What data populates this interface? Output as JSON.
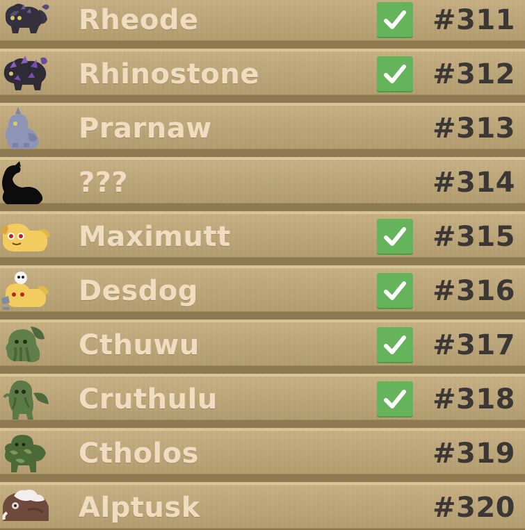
{
  "creatures": [
    {
      "name": "Rheode",
      "number": "#311",
      "caught": true,
      "icon": "rheode-sprite-icon"
    },
    {
      "name": "Rhinostone",
      "number": "#312",
      "caught": true,
      "icon": "rhinostone-sprite-icon"
    },
    {
      "name": "Prarnaw",
      "number": "#313",
      "caught": false,
      "icon": "prarnaw-sprite-icon"
    },
    {
      "name": "???",
      "number": "#314",
      "caught": false,
      "icon": "unknown-silhouette-icon"
    },
    {
      "name": "Maximutt",
      "number": "#315",
      "caught": true,
      "icon": "maximutt-sprite-icon"
    },
    {
      "name": "Desdog",
      "number": "#316",
      "caught": true,
      "icon": "desdog-sprite-icon"
    },
    {
      "name": "Cthuwu",
      "number": "#317",
      "caught": true,
      "icon": "cthuwu-sprite-icon"
    },
    {
      "name": "Cruthulu",
      "number": "#318",
      "caught": true,
      "icon": "cruthulu-sprite-icon"
    },
    {
      "name": "Ctholos",
      "number": "#319",
      "caught": false,
      "icon": "ctholos-sprite-icon"
    },
    {
      "name": "Alptusk",
      "number": "#320",
      "caught": false,
      "icon": "alptusk-sprite-icon"
    }
  ],
  "colors": {
    "row_background": "#bda77a",
    "name_text": "#f0dcc0",
    "number_text": "#3b3734",
    "checkbox": "#65b35a"
  },
  "check_icon": "checkmark-icon"
}
